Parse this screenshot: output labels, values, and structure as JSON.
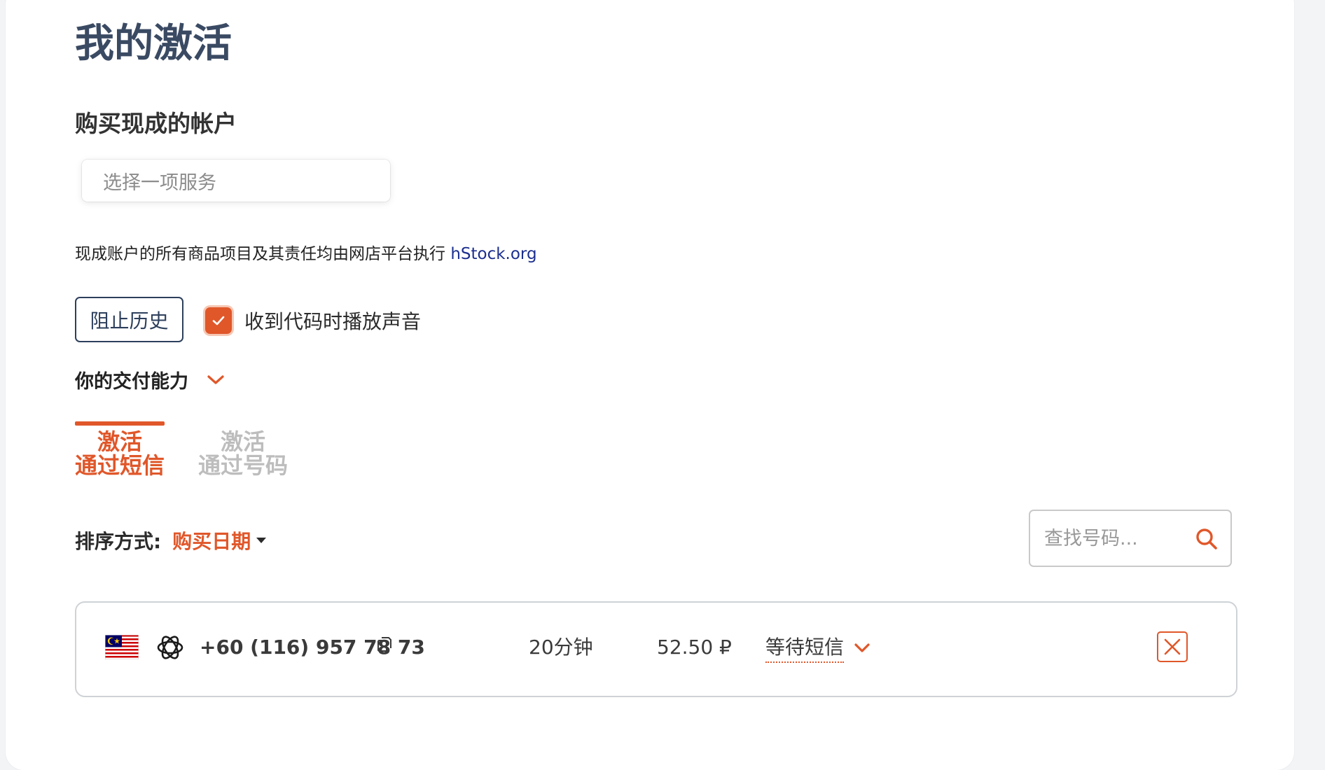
{
  "page": {
    "title": "我的激活"
  },
  "ready_accounts": {
    "heading": "购买现成的帐户",
    "select_placeholder": "选择一项服务",
    "notice_text": "现成账户的所有商品项目及其责任均由网店平台执行",
    "notice_link": "hStock.org"
  },
  "controls": {
    "block_history_label": "阻止历史",
    "sound_label": "收到代码时播放声音",
    "sound_checked": true,
    "capacity_label": "你的交付能力"
  },
  "tabs": [
    {
      "line1": "激活",
      "line2": "通过短信",
      "active": true
    },
    {
      "line1": "激活",
      "line2": "通过号码",
      "active": false
    }
  ],
  "sort": {
    "label": "排序方式:",
    "value": "购买日期"
  },
  "search": {
    "placeholder": "查找号码..."
  },
  "activations": [
    {
      "country_flag": "malaysia-flag",
      "service_icon": "openai-icon",
      "phone": "+60 (116) 957 78 73",
      "duration": "20分钟",
      "price": "52.50 ₽",
      "status": "等待短信"
    }
  ],
  "colors": {
    "accent": "#e0572a",
    "title": "#3a4a63",
    "link": "#1c2f8f"
  }
}
